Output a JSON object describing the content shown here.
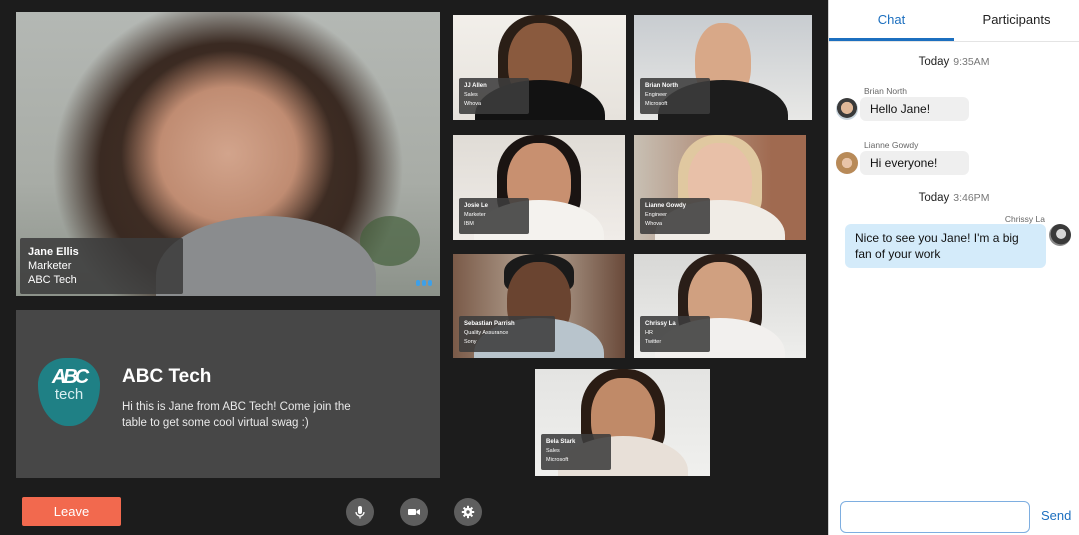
{
  "main_speaker": {
    "name": "Jane Ellis",
    "role": "Marketer",
    "company": "ABC Tech",
    "more_icon": "ellipsis-icon"
  },
  "booth": {
    "logo_text_top": "ABC",
    "logo_text_bottom": "tech",
    "title": "ABC Tech",
    "description": "Hi this is Jane from ABC Tech! Come join the table to get some cool virtual swag :)"
  },
  "participants": [
    {
      "name": "JJ Allen",
      "role": "Sales",
      "company": "Whova"
    },
    {
      "name": "Brian North",
      "role": "Engineer",
      "company": "Microsoft"
    },
    {
      "name": "Josie Le",
      "role": "Marketer",
      "company": "IBM"
    },
    {
      "name": "Lianne Gowdy",
      "role": "Engineer",
      "company": "Whova"
    },
    {
      "name": "Sebastian Parrish",
      "role": "Quality Assurance",
      "company": "Sony"
    },
    {
      "name": "Chrissy La",
      "role": "HR",
      "company": "Twitter"
    },
    {
      "name": "Bela Stark",
      "role": "Sales",
      "company": "Microsoft"
    }
  ],
  "controls": {
    "leave_label": "Leave",
    "leave_color": "#f2694e",
    "mic_icon": "microphone-icon",
    "camera_icon": "video-camera-icon",
    "settings_icon": "gear-icon"
  },
  "chat": {
    "tabs": [
      {
        "label": "Chat",
        "active": true
      },
      {
        "label": "Participants",
        "active": false
      }
    ],
    "accent": "#1c6fbf",
    "groups": [
      {
        "day": "Today",
        "time": "9:35AM"
      },
      {
        "day": "Today",
        "time": "3:46PM"
      }
    ],
    "messages": [
      {
        "sender": "Brian North",
        "text": "Hello Jane!",
        "direction": "incoming"
      },
      {
        "sender": "Lianne Gowdy",
        "text": "Hi everyone!",
        "direction": "incoming"
      },
      {
        "sender": "Chrissy La",
        "text": "Nice to see you Jane! I'm a big fan of your work",
        "direction": "outgoing"
      }
    ],
    "input_value": "",
    "input_placeholder": "",
    "send_label": "Send"
  }
}
